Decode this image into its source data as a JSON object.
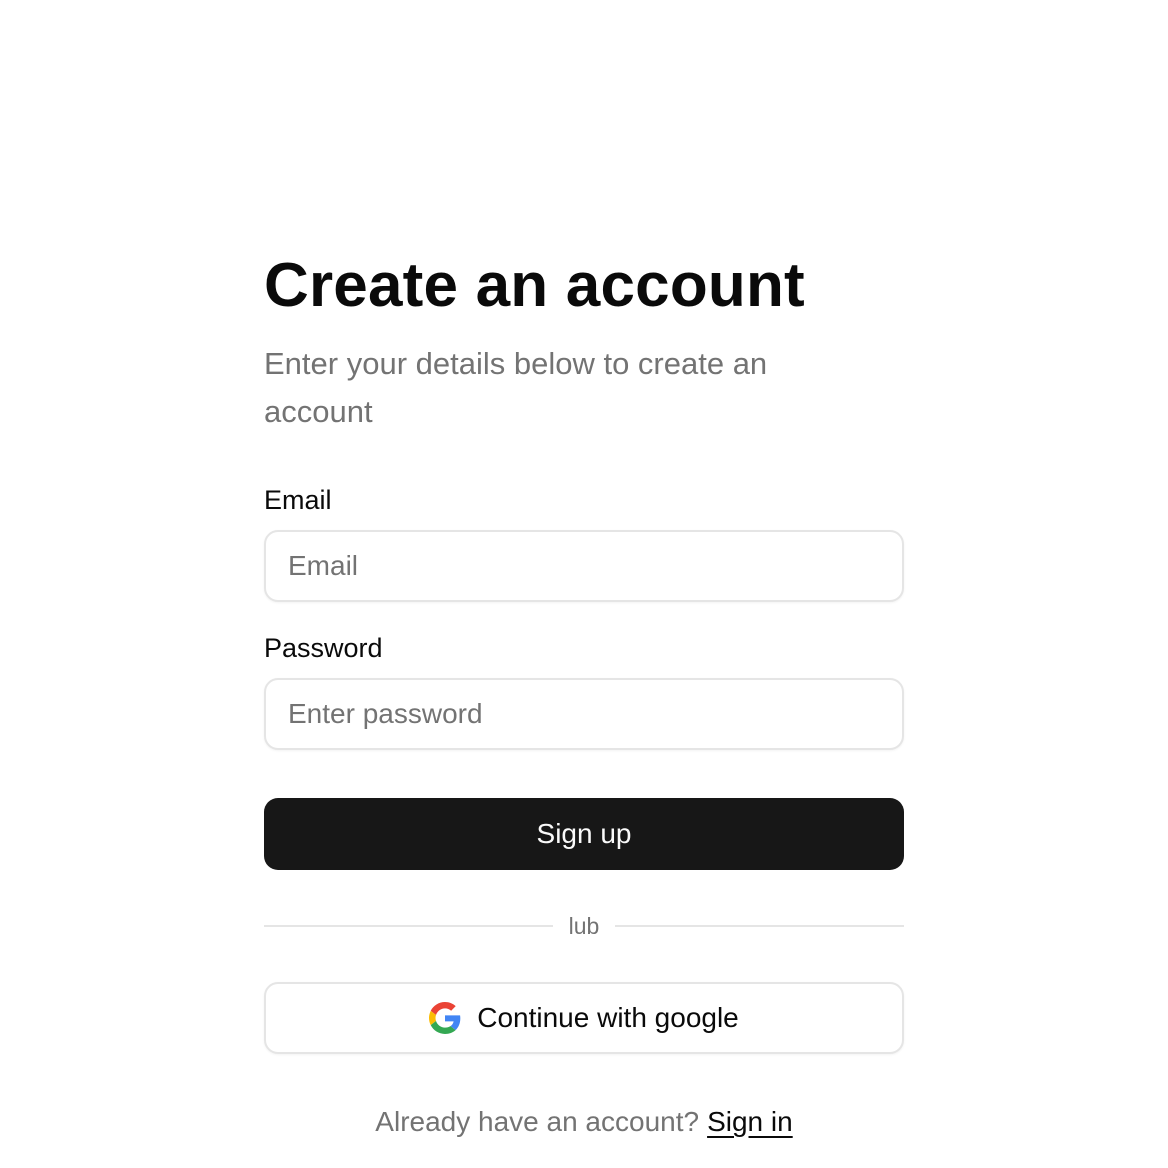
{
  "header": {
    "title": "Create an account",
    "subtitle": "Enter your details below to create an account"
  },
  "form": {
    "email": {
      "label": "Email",
      "placeholder": "Email",
      "value": ""
    },
    "password": {
      "label": "Password",
      "placeholder": "Enter password",
      "value": ""
    },
    "submit_label": "Sign up"
  },
  "divider": {
    "text": "lub"
  },
  "social": {
    "google_label": "Continue with google",
    "icon": "google-icon"
  },
  "footer": {
    "prompt": "Already have an account?",
    "link_label": "Sign in"
  },
  "colors": {
    "primary_button_bg": "#171717",
    "primary_button_text": "#fafafa",
    "muted_text": "#737373",
    "border": "#e5e5e5",
    "google_blue": "#4285F4",
    "google_red": "#EA4335",
    "google_yellow": "#FBBC05",
    "google_green": "#34A853"
  }
}
